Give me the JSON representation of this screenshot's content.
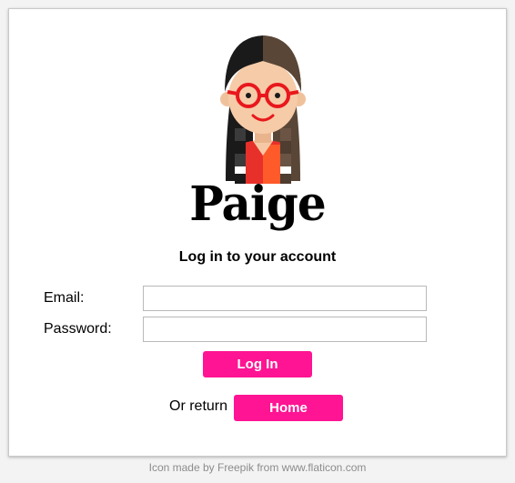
{
  "brand": {
    "name": "Paige"
  },
  "login": {
    "heading": "Log in to your account",
    "email_label": "Email:",
    "email_value": "",
    "password_label": "Password:",
    "password_value": "",
    "submit_label": "Log In"
  },
  "footer_nav": {
    "prefix": "Or return",
    "home_label": "Home"
  },
  "credit": {
    "text": "Icon made by Freepik from www.flaticon.com"
  },
  "icons": {
    "avatar": "girl-with-glasses-icon"
  },
  "colors": {
    "accent": "#ff1493",
    "button_text": "#ffffff",
    "credit_text": "#8c8c8c",
    "border": "#c9c9c9"
  }
}
